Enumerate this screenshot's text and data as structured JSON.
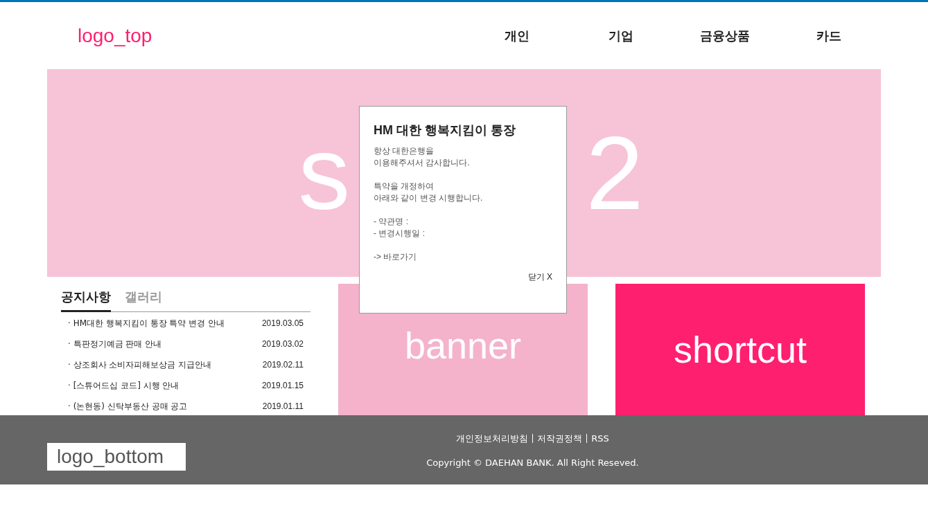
{
  "header": {
    "logo": "logo_top",
    "nav": [
      "개인",
      "기업",
      "금융상품",
      "카드"
    ]
  },
  "slide": {
    "fragments": [
      "s",
      "2"
    ]
  },
  "popup": {
    "title": "HM 대한 행복지킴이 통장",
    "paragraphs": [
      [
        "항상 대한은행을",
        "이용해주셔서 감사합니다."
      ],
      [
        "특약을 개정하여",
        "아래와 같이 변경 시행합니다."
      ],
      [
        "- 약관명 :",
        "- 변경시행일 :"
      ]
    ],
    "link": "-> 바로가기",
    "close": "닫기 X"
  },
  "board": {
    "tabs": [
      {
        "label": "공지사항",
        "selected": true
      },
      {
        "label": "갤러리",
        "selected": false
      }
    ],
    "rows": [
      {
        "title": "· HM대한 행복지킴이 통장 특약 변경 안내",
        "date": "2019.03.05"
      },
      {
        "title": "· 특판정기예금 판매 안내",
        "date": "2019.03.02"
      },
      {
        "title": "· 상조회사 소비자피해보상금 지급안내",
        "date": "2019.02.11"
      },
      {
        "title": "· [스튜어드십 코드] 시행 안내",
        "date": "2019.01.15"
      },
      {
        "title": "· (논현동) 신탁부동산 공매 공고",
        "date": "2019.01.11"
      }
    ]
  },
  "banner": "banner",
  "shortcut": "shortcut",
  "footer": {
    "logo": "logo_bottom",
    "links": [
      "개인정보처리방침",
      "저작권정책",
      "RSS"
    ],
    "copyright": "Copyright © DAEHAN BANK. All Right Reseved."
  }
}
